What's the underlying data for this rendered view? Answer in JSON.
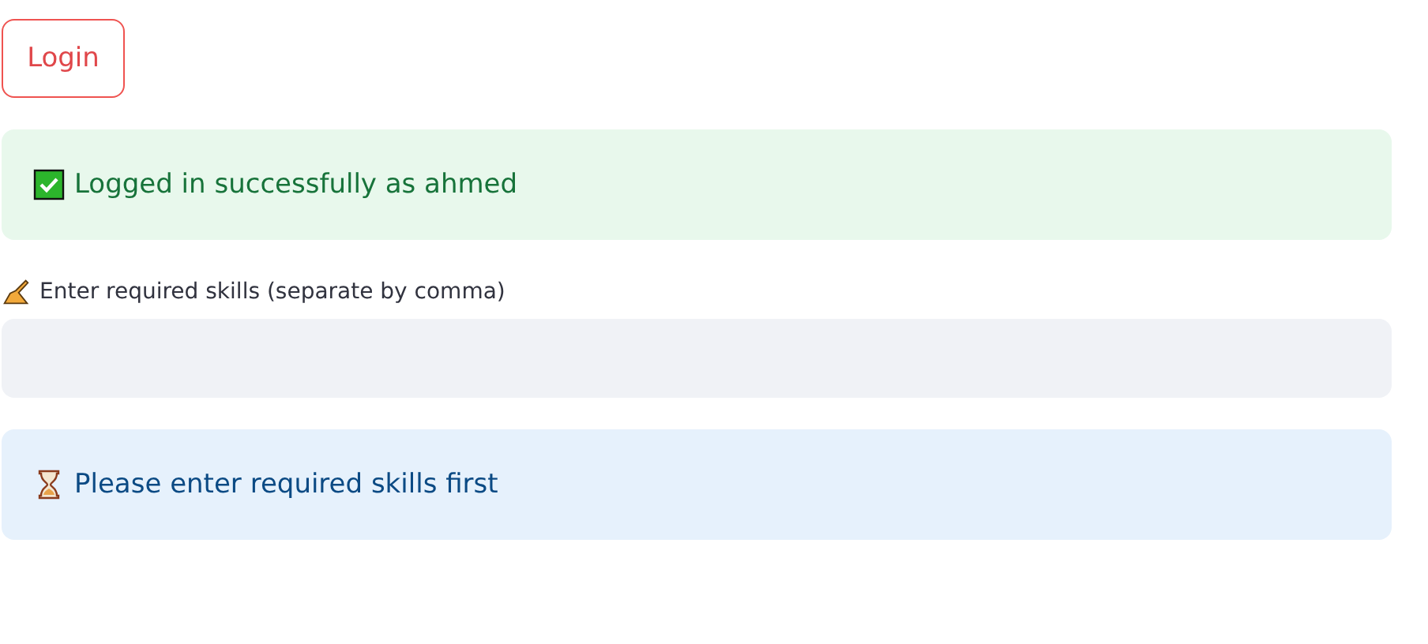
{
  "login_button": {
    "label": "Login"
  },
  "alerts_top": [
    {
      "kind": "success",
      "text": "Logged in successfully as ahmed"
    }
  ],
  "skills_field": {
    "label": "Enter required skills (separate by comma)"
  },
  "alerts_bottom": [
    {
      "kind": "info",
      "text": "Please enter required skills first"
    }
  ]
}
